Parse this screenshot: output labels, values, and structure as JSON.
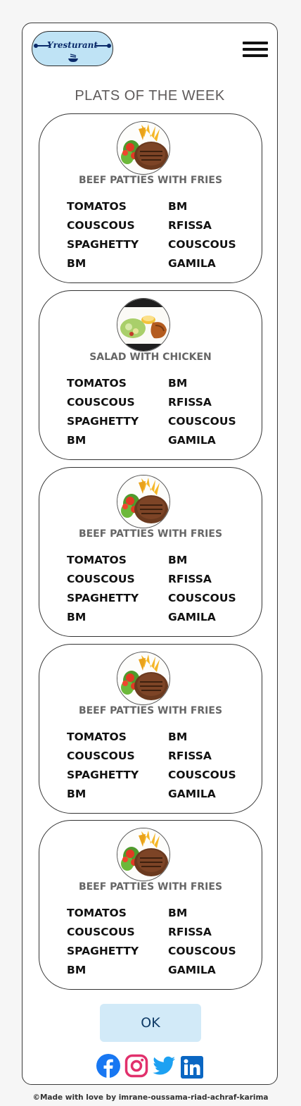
{
  "header": {
    "logo_text": "Yresturant",
    "logo_icon": "bowl-icon",
    "menu_icon": "hamburger-menu-icon"
  },
  "section_title": "PLATS OF THE WEEK",
  "cards": [
    {
      "dish": "BEEF PATTIES WITH FRIES",
      "image": "beef-patties-image",
      "items": [
        "TOMATOS",
        "BM",
        "COUSCOUS",
        "RFISSA",
        "SPAGHETTY",
        "COUSCOUS",
        "BM",
        "GAMILA"
      ]
    },
    {
      "dish": "SALAD WITH CHICKEN",
      "image": "salad-chicken-image",
      "items": [
        "TOMATOS",
        "BM",
        "COUSCOUS",
        "RFISSA",
        "SPAGHETTY",
        "COUSCOUS",
        "BM",
        "GAMILA"
      ]
    },
    {
      "dish": "BEEF PATTIES WITH FRIES",
      "image": "beef-patties-image",
      "items": [
        "TOMATOS",
        "BM",
        "COUSCOUS",
        "RFISSA",
        "SPAGHETTY",
        "COUSCOUS",
        "BM",
        "GAMILA"
      ]
    },
    {
      "dish": "BEEF PATTIES WITH FRIES",
      "image": "beef-patties-image",
      "items": [
        "TOMATOS",
        "BM",
        "COUSCOUS",
        "RFISSA",
        "SPAGHETTY",
        "COUSCOUS",
        "BM",
        "GAMILA"
      ]
    },
    {
      "dish": "BEEF PATTIES WITH FRIES",
      "image": "beef-patties-image",
      "items": [
        "TOMATOS",
        "BM",
        "COUSCOUS",
        "RFISSA",
        "SPAGHETTY",
        "COUSCOUS",
        "BM",
        "GAMILA"
      ]
    }
  ],
  "ok_button": "OK",
  "social": [
    "facebook-icon",
    "instagram-icon",
    "twitter-icon",
    "linkedin-icon"
  ],
  "colors": {
    "accent_light_blue": "#d2eaf8",
    "facebook": "#1877f2",
    "instagram": "#e1306c",
    "twitter": "#1da1f2",
    "linkedin": "#0a66c2"
  },
  "footer": {
    "copyright": "©Made with love by  imrane-oussama-riad-achraf-karima"
  }
}
